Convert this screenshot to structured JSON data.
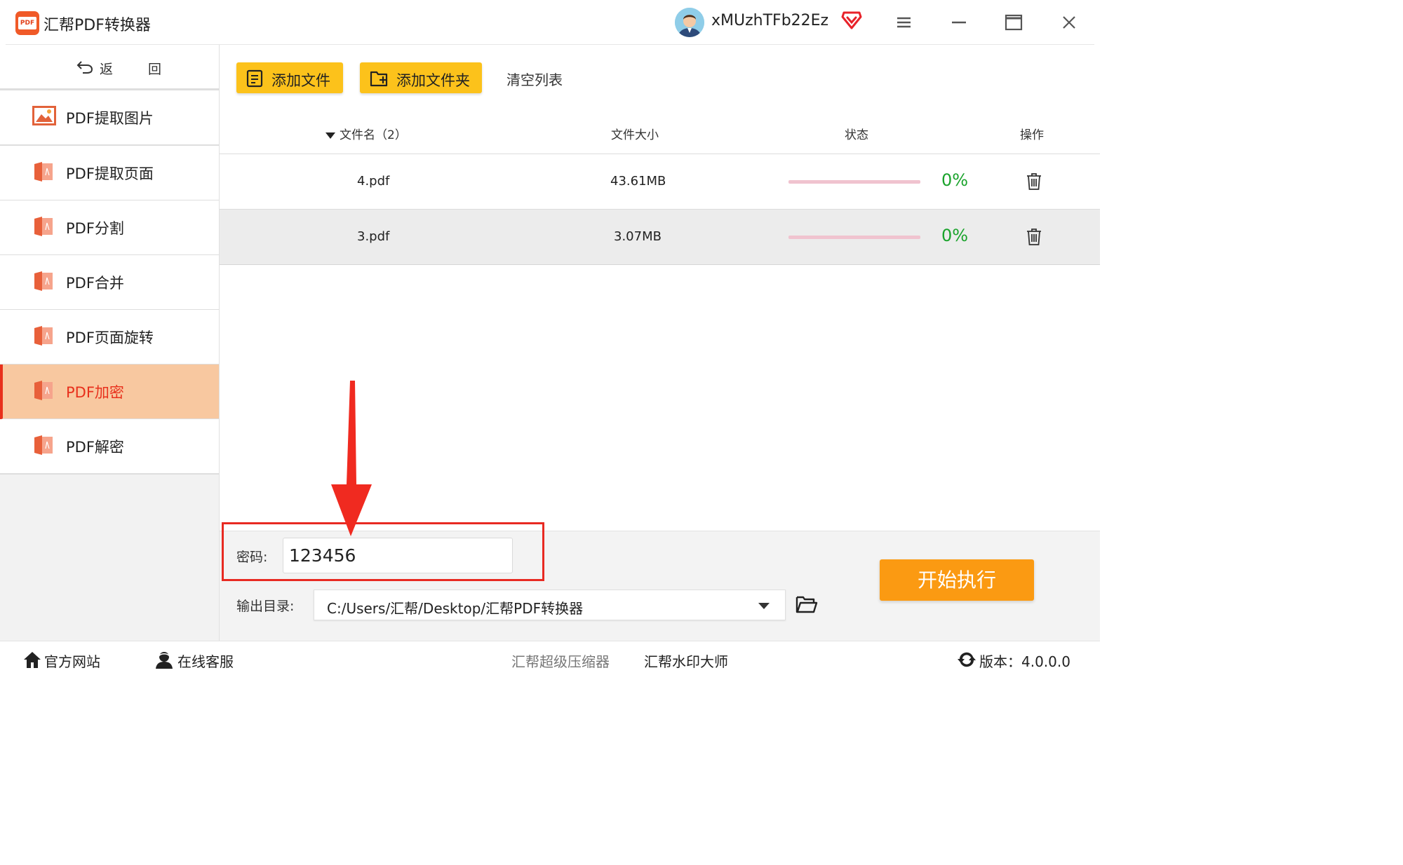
{
  "app": {
    "title": "汇帮PDF转换器",
    "logo_text": "PDF"
  },
  "user": {
    "name": "xMUzhTFb22Ez"
  },
  "sidebar": {
    "back_label": "返 回",
    "items": [
      {
        "label": "PDF提取图片",
        "icon": "image-icon"
      },
      {
        "label": "PDF提取页面",
        "icon": "pdf-file-icon"
      },
      {
        "label": "PDF分割",
        "icon": "pdf-file-icon"
      },
      {
        "label": "PDF合并",
        "icon": "pdf-file-icon"
      },
      {
        "label": "PDF页面旋转",
        "icon": "pdf-file-icon"
      },
      {
        "label": "PDF加密",
        "icon": "pdf-file-icon",
        "active": true
      },
      {
        "label": "PDF解密",
        "icon": "pdf-file-icon"
      }
    ]
  },
  "toolbar": {
    "add_file": "添加文件",
    "add_folder": "添加文件夹",
    "clear_list": "清空列表"
  },
  "table": {
    "headers": {
      "name": "文件名（2）",
      "size": "文件大小",
      "status": "状态",
      "action": "操作"
    },
    "rows": [
      {
        "name": "4.pdf",
        "size": "43.61MB",
        "progress": "0%"
      },
      {
        "name": "3.pdf",
        "size": "3.07MB",
        "progress": "0%"
      }
    ]
  },
  "form": {
    "password_label": "密码:",
    "password_value": "123456",
    "output_label": "输出目录:",
    "output_path": "C:/Users/汇帮/Desktop/汇帮PDF转换器",
    "start_button": "开始执行"
  },
  "footer": {
    "website": "官方网站",
    "support": "在线客服",
    "compressor": "汇帮超级压缩器",
    "watermark": "汇帮水印大师",
    "version": "版本：4.0.0.0"
  },
  "colors": {
    "accent_yellow": "#fcc21b",
    "start_orange": "#fb9a12",
    "active_bg": "#f8c8a0",
    "active_text": "#e8301c",
    "progress_green": "#1aa32c",
    "highlight_red": "#e82a22"
  }
}
